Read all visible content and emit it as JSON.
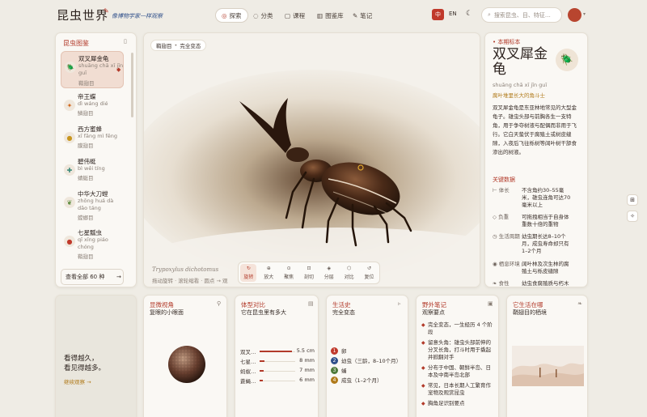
{
  "header": {
    "logo": "昆虫世界",
    "tagline": "像博物学家一样观察",
    "nav": [
      {
        "label": "探索",
        "icon": "compass-icon"
      },
      {
        "label": "分类",
        "icon": "target-icon"
      },
      {
        "label": "课程",
        "icon": "book-icon"
      },
      {
        "label": "图鉴库",
        "icon": "library-icon"
      },
      {
        "label": "笔记",
        "icon": "pencil-icon"
      }
    ],
    "lang_zh": "中",
    "lang_en": "EN",
    "search_placeholder": "搜索昆虫、目、特征…"
  },
  "sidebar": {
    "title": "昆虫图鉴",
    "items": [
      {
        "name": "双叉犀金龟",
        "pinyin": "shuāng chā xī jīn guī",
        "family": "鞘翅目",
        "icon": "beetle-icon"
      },
      {
        "name": "帝王蝶",
        "pinyin": "dì wáng dié",
        "family": "鳞翅目",
        "icon": "butterfly-icon"
      },
      {
        "name": "西方蜜蜂",
        "pinyin": "xī fāng mì fēng",
        "family": "膜翅目",
        "icon": "bee-icon"
      },
      {
        "name": "碧伟蜓",
        "pinyin": "bì wěi tíng",
        "family": "蜻蜓目",
        "icon": "dragonfly-icon"
      },
      {
        "name": "中华大刀螳",
        "pinyin": "zhōng huá dà dāo táng",
        "family": "螳螂目",
        "icon": "mantis-icon"
      },
      {
        "name": "七星瓢虫",
        "pinyin": "qī xīng piáo chóng",
        "family": "鞘翅目",
        "icon": "ladybug-icon"
      }
    ],
    "show_all": "查看全部 60 种",
    "show_all_arrow": "→"
  },
  "stage": {
    "tag_family": "鞘翅目",
    "tag_sep": "•",
    "tag_state": "完全变态",
    "latin": "Trypoxylus dichotomus",
    "hint": "拖动旋转 · 滚轮缩看 · 圆点 → 观",
    "tools": [
      {
        "label": "旋转",
        "icon": "rotate-icon"
      },
      {
        "label": "放大",
        "icon": "zoom-in-icon"
      },
      {
        "label": "聚焦",
        "icon": "focus-icon"
      },
      {
        "label": "剖切",
        "icon": "section-icon"
      },
      {
        "label": "分层",
        "icon": "layers-icon"
      },
      {
        "label": "对比",
        "icon": "cube-icon"
      },
      {
        "label": "复位",
        "icon": "reset-icon"
      }
    ]
  },
  "detail": {
    "kicker": "本期标本",
    "title_line1": "双叉犀金",
    "title_line2": "龟",
    "pinyin": "shuāng chā xī jīn guī",
    "subtitle": "腐叶堆里长大的角斗士",
    "desc": "双叉犀金龟是东亚林地常见的大型金龟子。雄虫头部与前胸各生一支特角，用于争夺树液与配偶而非用于飞行。它白天蛰伏于腐殖土或树皮缝隙，入夜后飞往栎树等阔叶树干舔食渗出的树液。",
    "key_title": "关键数据",
    "facts": [
      {
        "k": "体长",
        "v": "不含角约30–55毫米，雄虫连角可达70毫米以上",
        "icon": "ruler-icon"
      },
      {
        "k": "负重",
        "v": "可拖拽相当于自身体重数十倍的重物",
        "icon": "weight-icon"
      },
      {
        "k": "生活周期",
        "v": "幼虫期长达8–10个月，成虫寿命却只有1–2个月",
        "icon": "clock-icon"
      },
      {
        "k": "栖息环境",
        "v": "阔叶林及次生林的腐殖土与栎皮缝隙",
        "icon": "pin-icon"
      },
      {
        "k": "食性",
        "v": "幼虫食腐殖质与朽木",
        "icon": "leaf-icon"
      }
    ]
  },
  "cards": {
    "quote": {
      "line1": "看得越久，",
      "line2": "看见得越多。",
      "link": "继续观察 →"
    },
    "compound": {
      "title": "显微视角",
      "sub": "复眼的小眼面"
    },
    "size": {
      "title": "体型对比",
      "sub": "它在昆虫里有多大",
      "rows": [
        {
          "name": "双叉…",
          "value": "5.5 cm",
          "fraction": 0.92
        },
        {
          "name": "七星…",
          "value": "8 mm",
          "fraction": 0.14
        },
        {
          "name": "蚂蚁…",
          "value": "7 mm",
          "fraction": 0.12
        },
        {
          "name": "蒼蝇…",
          "value": "6 mm",
          "fraction": 0.1
        }
      ]
    },
    "life": {
      "title": "生活史",
      "sub": "完全变态",
      "stages": [
        {
          "n": "1",
          "label": "卵",
          "color": "#c0392b"
        },
        {
          "n": "2",
          "label": "幼虫（三龄，8–10个月）",
          "color": "#2f4f8a"
        },
        {
          "n": "3",
          "label": "蛹",
          "color": "#4e7a3a"
        },
        {
          "n": "4",
          "label": "成虫（1–2个月）",
          "color": "#b07a1a"
        }
      ]
    },
    "notes": {
      "title": "野外笔记",
      "sub": "观察要点",
      "items": [
        "完全变态，一生经历 4 个阶段",
        "留意头角：雄虫头部前伸的分叉长角，打斗时用于撬起并掀翻对手",
        "分布于中国、朝鲜半岛、日本及中南半岛北部",
        "常见，日本长期人工繁育作宠物及观赏昆虫",
        "胸角足识别要点"
      ]
    },
    "habitat": {
      "title": "它生活在哪",
      "sub": "鞘翅目的栖境"
    }
  },
  "colors": {
    "accent": "#b23a2a",
    "bg": "#efece5",
    "card": "#faf8f4"
  }
}
